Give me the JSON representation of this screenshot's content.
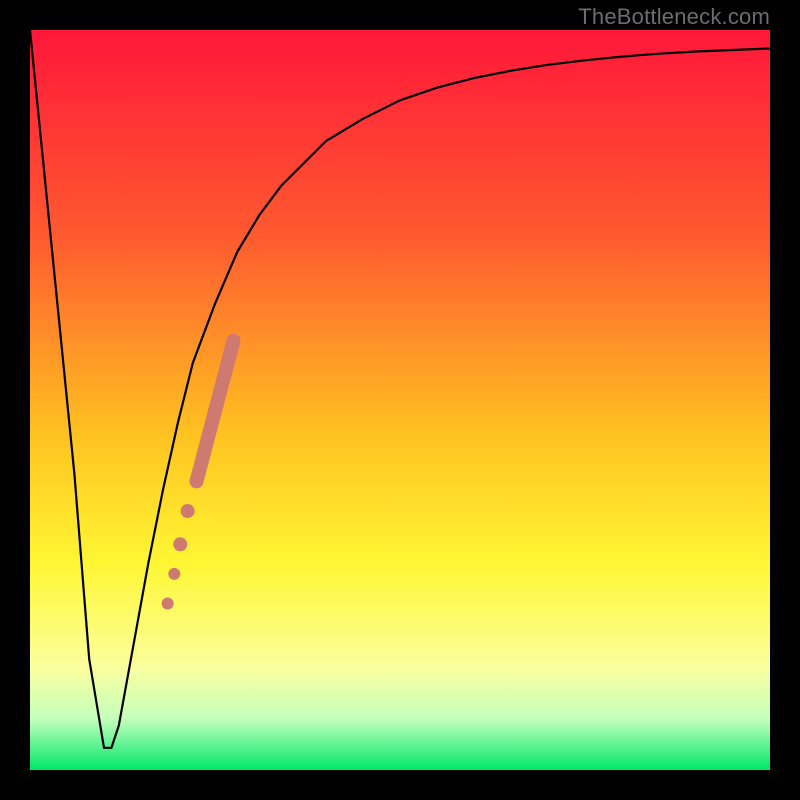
{
  "watermark": "TheBottleneck.com",
  "colors": {
    "frame": "#000000",
    "curve": "#000000",
    "marker": "#cf7a71",
    "grad_top": "#ff173a",
    "grad_mid1": "#ff8a2a",
    "grad_mid2": "#ffe521",
    "grad_mid3": "#fdff8a",
    "grad_mid4": "#c9ffb6",
    "grad_bot": "#00e86a"
  },
  "chart_data": {
    "type": "line",
    "title": "",
    "xlabel": "",
    "ylabel": "",
    "xlim": [
      0,
      100
    ],
    "ylim": [
      0,
      100
    ],
    "grid": false,
    "legend": false,
    "series": [
      {
        "name": "bottleneck-curve",
        "x": [
          0,
          3,
          6,
          8,
          10,
          11,
          12,
          14,
          16,
          18,
          20,
          22,
          25,
          28,
          31,
          34,
          37,
          40,
          45,
          50,
          55,
          60,
          65,
          70,
          75,
          80,
          85,
          90,
          95,
          100
        ],
        "y": [
          100,
          70,
          40,
          15,
          3,
          3,
          6,
          17,
          28,
          38,
          47,
          55,
          63,
          70,
          75,
          79,
          82,
          85,
          88,
          90.5,
          92.2,
          93.5,
          94.5,
          95.3,
          95.9,
          96.4,
          96.8,
          97.1,
          97.3,
          97.5
        ]
      }
    ],
    "markers": [
      {
        "shape": "segment",
        "x1": 22.5,
        "y1": 39.0,
        "x2": 27.5,
        "y2": 58.0,
        "width": 14
      },
      {
        "shape": "circle",
        "cx": 21.3,
        "cy": 35.0,
        "r": 7
      },
      {
        "shape": "circle",
        "cx": 20.3,
        "cy": 30.5,
        "r": 7
      },
      {
        "shape": "circle",
        "cx": 19.5,
        "cy": 26.5,
        "r": 6
      },
      {
        "shape": "circle",
        "cx": 18.6,
        "cy": 22.5,
        "r": 6
      }
    ],
    "gradient_stops": [
      {
        "offset": 0.0,
        "color": "#ff173a"
      },
      {
        "offset": 0.28,
        "color": "#ff5a2f"
      },
      {
        "offset": 0.55,
        "color": "#ffc321"
      },
      {
        "offset": 0.72,
        "color": "#fff633"
      },
      {
        "offset": 0.86,
        "color": "#fbff9d"
      },
      {
        "offset": 0.93,
        "color": "#c5ffbd"
      },
      {
        "offset": 1.0,
        "color": "#00e86a"
      }
    ]
  }
}
